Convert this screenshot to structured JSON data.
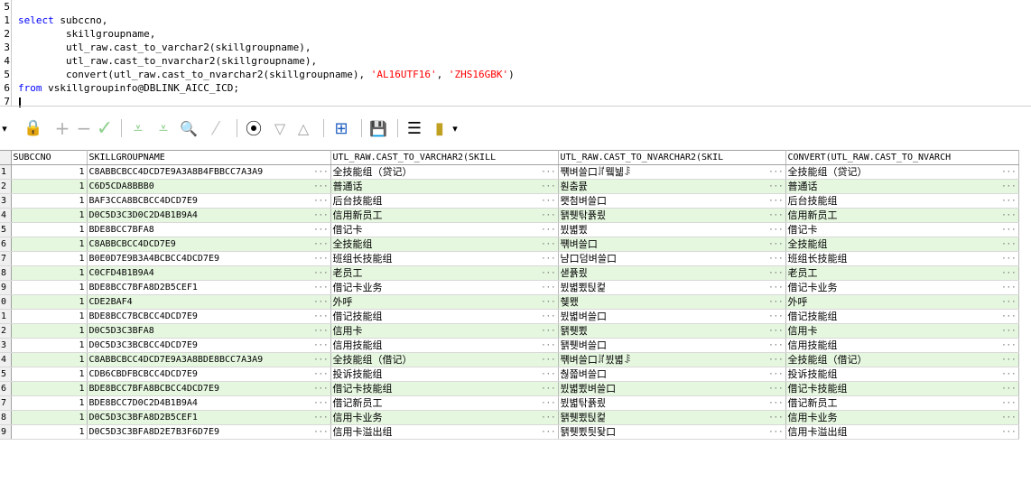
{
  "editor": {
    "line_numbers": [
      "5",
      "1",
      "2",
      "3",
      "4",
      "5",
      "6",
      "7"
    ],
    "lines": [
      {
        "kw": "select",
        "rest": " subccno,"
      },
      {
        "kw": "",
        "rest": "        skillgroupname,"
      },
      {
        "kw": "",
        "rest": "        utl_raw.cast_to_varchar2(skillgroupname),"
      },
      {
        "kw": "",
        "rest": "        utl_raw.cast_to_nvarchar2(skillgroupname),"
      },
      {
        "kw": "",
        "rest": "        convert(utl_raw.cast_to_nvarchar2(skillgroupname), ",
        "s1": "'AL16UTF16'",
        "mid": ", ",
        "s2": "'ZHS16GBK'",
        "end": ")"
      },
      {
        "kw": "from",
        "rest": " vskillgroupinfo@DBLINK_AICC_ICD;"
      }
    ]
  },
  "toolbar": {
    "dropdown_glyph": "▾",
    "lock_glyph": "🔒",
    "add_glyph": "+",
    "remove_glyph": "−",
    "post_glyph": "✓",
    "filter_glyph": "⩡",
    "clear_filter_glyph": "⩡",
    "find_glyph": "🔍",
    "clear_glyph": "⁄",
    "query_glyph": "⦿",
    "next_glyph": "▽",
    "prev_glyph": "△",
    "explain_glyph": "⊞",
    "save_glyph": "💾",
    "export_glyph": "☰",
    "chart_glyph": "▮",
    "more_glyph": "▾"
  },
  "grid": {
    "headers": [
      "",
      "SUBCCNO",
      "SKILLGROUPNAME",
      "UTL_RAW.CAST_TO_VARCHAR2(SKILL",
      "UTL_RAW.CAST_TO_NVARCHAR2(SKIL",
      "CONVERT(UTL_RAW.CAST_TO_NVARCH"
    ],
    "rows": [
      [
        "1",
        "1",
        "C8ABBCBCC4DCD7E9A3A8B4FBBCC7A3A9",
        "全技能组（贷记）",
        "쨲벼쓸口ꄨ뮄뉇ꄩ",
        "全技能组（贷记）"
      ],
      [
        "2",
        "1",
        "C6D5CDA8BBB0",
        "普通话",
        "훤춤뮰",
        "普通话"
      ],
      [
        "3",
        "1",
        "BAF3CCA8BCBCC4DCD7E9",
        "后台技能组",
        "뫳첨벼쓸口",
        "后台技能组"
      ],
      [
        "4",
        "1",
        "D0C5D3C3D0C2D4B1B9A4",
        "信用新员工",
        "됅퓃탂퓱릤",
        "信用新员工"
      ],
      [
        "5",
        "1",
        "BDE8BCC7BFA8",
        "借记卡",
        "뷨볇뾨",
        "借记卡"
      ],
      [
        "6",
        "1",
        "C8ABBCBCC4DCD7E9",
        "全技能组",
        "쨲벼쓸口",
        "全技能组"
      ],
      [
        "7",
        "1",
        "B0E0D7E9B3A4BCBCC4DCD7E9",
        "班组长技能组",
        "냠口덤벼쓸口",
        "班组长技能组"
      ],
      [
        "8",
        "1",
        "C0CFD4B1B9A4",
        "老员工",
        "샏퓱릤",
        "老员工"
      ],
      [
        "9",
        "1",
        "BDE8BCC7BFA8D2B5CEF1",
        "借记卡业务",
        "뷨볇뾨틵컱",
        "借记卡业务"
      ],
      [
        "0",
        "1",
        "CDE2BAF4",
        "外呼",
        "췢뫴",
        "外呼"
      ],
      [
        "1",
        "1",
        "BDE8BCC7BCBCC4DCD7E9",
        "借记技能组",
        "뷨볇벼쓸口",
        "借记技能组"
      ],
      [
        "2",
        "1",
        "D0C5D3C3BFA8",
        "信用卡",
        "됅퓃뾨",
        "信用卡"
      ],
      [
        "3",
        "1",
        "D0C5D3C3BCBCC4DCD7E9",
        "信用技能组",
        "됅퓃벼쓸口",
        "信用技能组"
      ],
      [
        "4",
        "1",
        "C8ABBCBCC4DCD7E9A3A8BDE8BCC7A3A9",
        "全技能组（借记）",
        "쨲벼쓸口ꄨ뷨볇ꄩ",
        "全技能组（借记）"
      ],
      [
        "5",
        "1",
        "CDB6CBDFBCBCC4DCD7E9",
        "投诉技能组",
        "춶쯟벼쓸口",
        "投诉技能组"
      ],
      [
        "6",
        "1",
        "BDE8BCC7BFA8BCBCC4DCD7E9",
        "借记卡技能组",
        "뷨볇뾨벼쓸口",
        "借记卡技能组"
      ],
      [
        "7",
        "1",
        "BDE8BCC7D0C2D4B1B9A4",
        "借记新员工",
        "뷨볇탂퓱릤",
        "借记新员工"
      ],
      [
        "8",
        "1",
        "D0C5D3C3BFA8D2B5CEF1",
        "信用卡业务",
        "됅퓃뾨틵컱",
        "信用卡业务"
      ],
      [
        "9",
        "1",
        "D0C5D3C3BFA8D2E7B3F6D7E9",
        "信用卡溢出组",
        "됅퓃뾨틧돶口",
        "信用卡溢出组"
      ]
    ],
    "ellipsis": "···"
  }
}
